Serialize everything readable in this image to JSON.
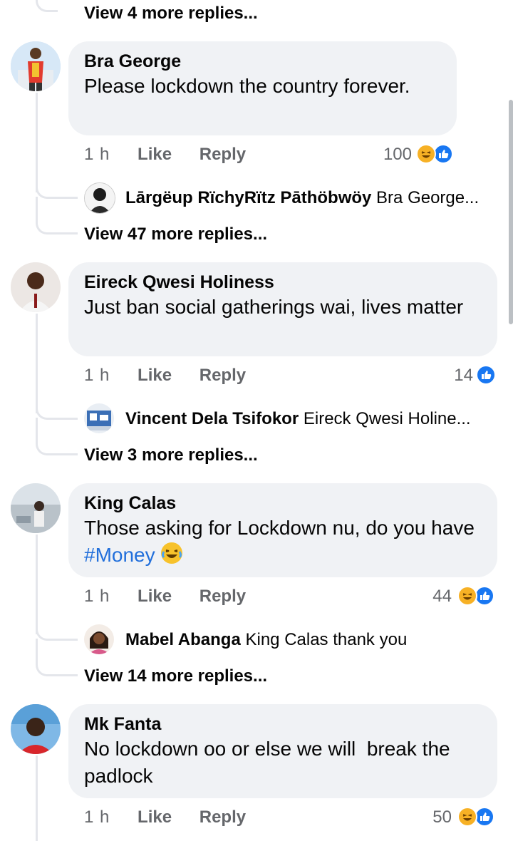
{
  "top_more": "View 4 more replies...",
  "comments": [
    {
      "name": "Bra George",
      "text": "Please lockdown the country forever.",
      "time": "1 h",
      "like": "Like",
      "reply": "Reply",
      "count": "100",
      "reactions": [
        "haha",
        "like"
      ],
      "reply_preview": {
        "name": "Lārgëup RïchyRïtz Pāthöbwöy",
        "text": "Bra George..."
      },
      "more": "View 47 more replies..."
    },
    {
      "name": "Eireck Qwesi Holiness",
      "text": "Just ban social gatherings wai, lives matter",
      "time": "1 h",
      "like": "Like",
      "reply": "Reply",
      "count": "14",
      "reactions": [
        "like"
      ],
      "reply_preview": {
        "name": "Vincent Dela Tsifokor",
        "text": "Eireck Qwesi Holine..."
      },
      "more": "View 3 more replies..."
    },
    {
      "name": "King Calas",
      "text_prefix": "Those asking for Lockdown nu, do you have ",
      "hashtag": "#Money",
      "emoji": "😂",
      "time": "1 h",
      "like": "Like",
      "reply": "Reply",
      "count": "44",
      "reactions": [
        "haha",
        "like"
      ],
      "reply_preview": {
        "name": "Mabel Abanga",
        "text": "King Calas thank you"
      },
      "more": "View 14 more replies..."
    },
    {
      "name": "Mk Fanta",
      "text": "No lockdown oo or else we will  break the padlock",
      "time": "1 h",
      "like": "Like",
      "reply": "Reply",
      "count": "50",
      "reactions": [
        "haha",
        "like"
      ]
    }
  ],
  "colors": {
    "bubble": "#f0f2f5",
    "hashtag": "#216fdb",
    "muted": "#65676b",
    "thread_line": "#e4e6eb",
    "like_blue": "#1877f2",
    "haha_yellow": "#f7b125"
  }
}
